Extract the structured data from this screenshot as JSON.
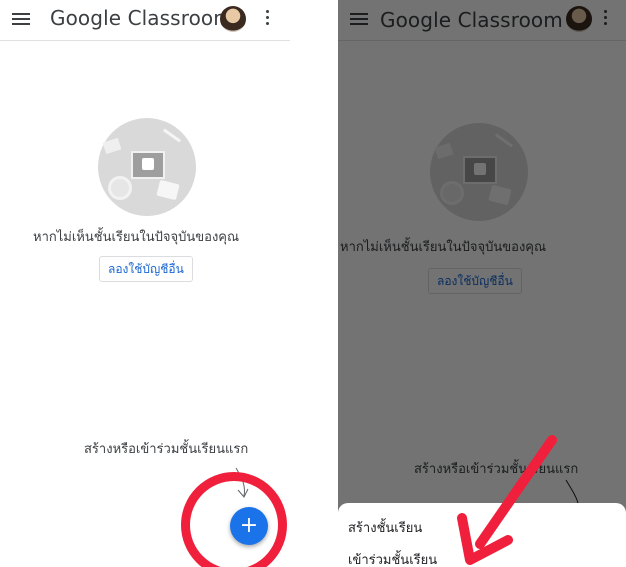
{
  "app": {
    "title": "Google Classroom"
  },
  "empty_state": {
    "message": "หากไม่เห็นชั้นเรียนในปัจจุบันของคุณ",
    "switch_account_label": "ลองใช้บัญชีอื่น",
    "hint": "สร้างหรือเข้าร่วมชั้นเรียนแรก"
  },
  "fab": {
    "label": "+"
  },
  "sheet": {
    "items": [
      {
        "label": "สร้างชั้นเรียน"
      },
      {
        "label": "เข้าร่วมชั้นเรียน"
      }
    ]
  },
  "annotation_color": "#f0203c",
  "accent": "#1a73e8"
}
